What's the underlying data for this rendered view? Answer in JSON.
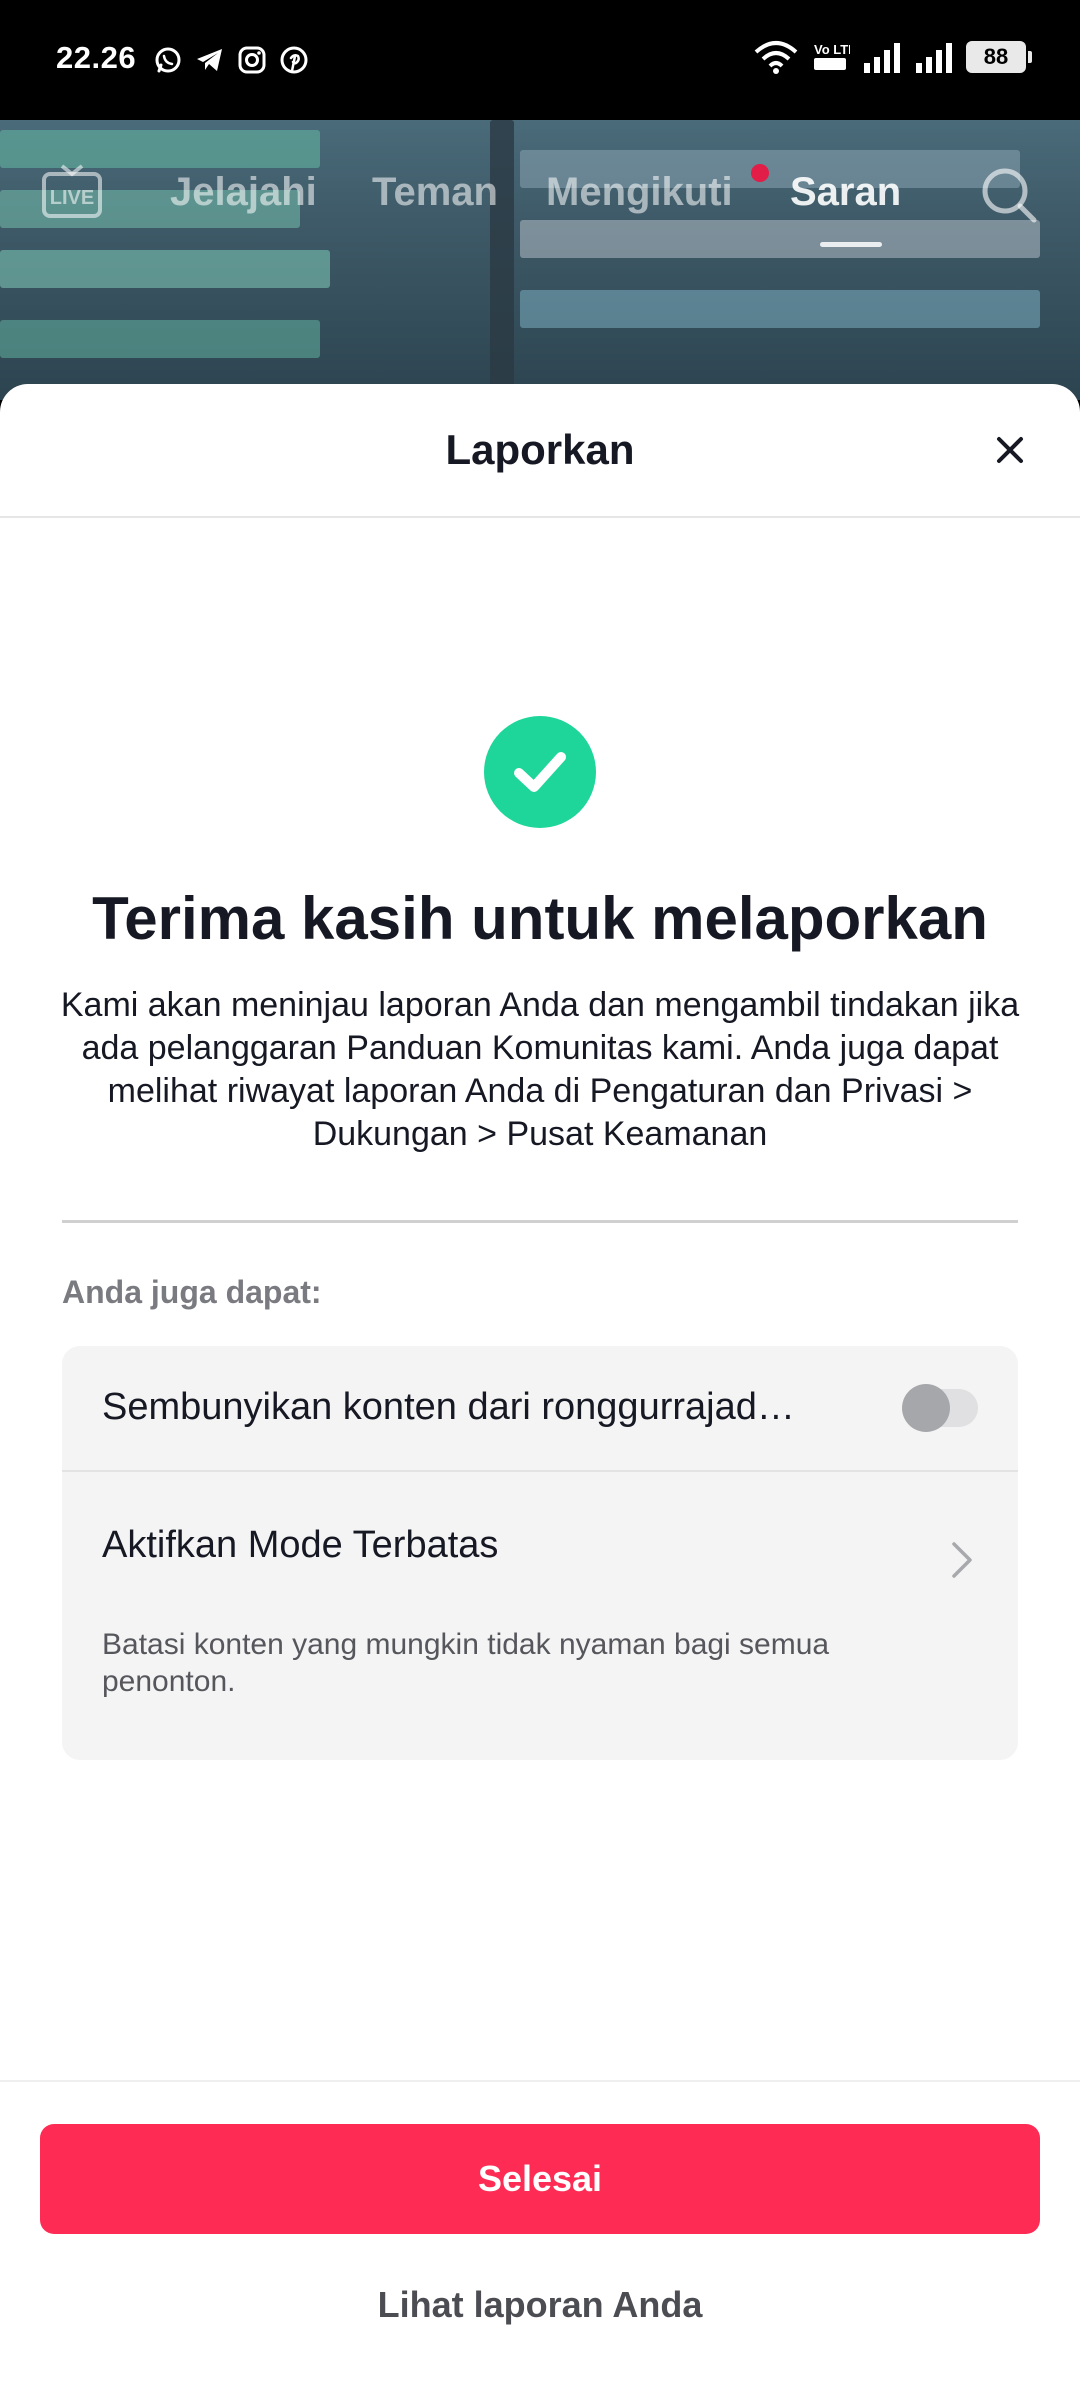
{
  "status_bar": {
    "time": "22.26",
    "app_icons": [
      "whatsapp-icon",
      "telegram-icon",
      "instagram-icon",
      "pinterest-icon"
    ],
    "network_label": "Vo LTE",
    "battery": "88"
  },
  "top_nav": {
    "live_label": "LIVE",
    "tabs": [
      {
        "label": "Jelajahi"
      },
      {
        "label": "Teman"
      },
      {
        "label": "Mengikuti"
      },
      {
        "label": "Saran",
        "active": true
      }
    ]
  },
  "sheet": {
    "title": "Laporkan",
    "confirmation": {
      "title": "Terima kasih untuk melaporkan",
      "body": "Kami akan meninjau laporan Anda dan mengambil tindakan jika ada pelanggaran Panduan Komunitas kami. Anda juga dapat melihat riwayat laporan Anda di Pengaturan dan Privasi > Dukungan > Pusat Keamanan"
    },
    "also_label": "Anda juga dapat:",
    "options": {
      "hide_content_label": "Sembunyikan konten dari ronggurrajad…",
      "hide_content_enabled": false,
      "restricted_mode_label": "Aktifkan Mode Terbatas",
      "restricted_mode_desc": "Batasi konten yang mungkin tidak nyaman bagi semua penonton."
    },
    "done_label": "Selesai",
    "view_reports_label": "Lihat laporan Anda"
  },
  "colors": {
    "accent": "#fe2c55",
    "success": "#1fd69a",
    "text_primary": "#161823"
  }
}
